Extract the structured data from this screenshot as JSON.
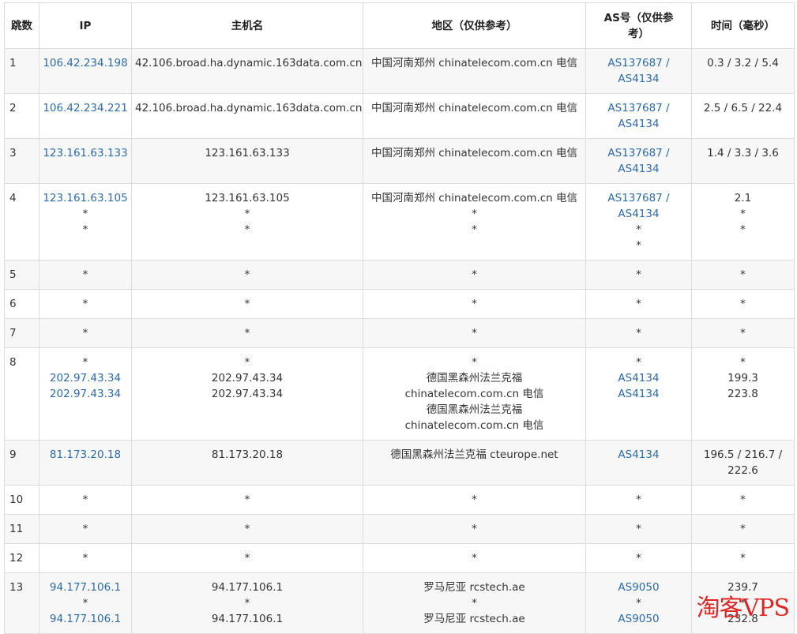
{
  "headers": {
    "hop": "跳数",
    "ip": "IP",
    "host": "主机名",
    "region": "地区（仅供参考）",
    "asn": "AS号（仅供参考）",
    "time": "时间（毫秒）"
  },
  "rows": [
    {
      "hop": "1",
      "ip": [
        "106.42.234.198"
      ],
      "host": [
        "42.106.broad.ha.dynamic.163data.com.cn"
      ],
      "region": [
        "中国河南郑州 chinatelecom.com.cn 电信"
      ],
      "asn": [
        "AS137687 /",
        "AS4134"
      ],
      "time": [
        "0.3 / 3.2 / 5.4"
      ]
    },
    {
      "hop": "2",
      "ip": [
        "106.42.234.221"
      ],
      "host": [
        "42.106.broad.ha.dynamic.163data.com.cn"
      ],
      "region": [
        "中国河南郑州 chinatelecom.com.cn 电信"
      ],
      "asn": [
        "AS137687 /",
        "AS4134"
      ],
      "time": [
        "2.5 / 6.5 / 22.4"
      ]
    },
    {
      "hop": "3",
      "ip": [
        "123.161.63.133"
      ],
      "host": [
        "123.161.63.133"
      ],
      "region": [
        "中国河南郑州 chinatelecom.com.cn 电信"
      ],
      "asn": [
        "AS137687 /",
        "AS4134"
      ],
      "time": [
        "1.4 / 3.3 / 3.6"
      ]
    },
    {
      "hop": "4",
      "ip": [
        "123.161.63.105",
        "*",
        "*"
      ],
      "host": [
        "123.161.63.105",
        "*",
        "*"
      ],
      "region": [
        "中国河南郑州 chinatelecom.com.cn 电信",
        "*",
        "*"
      ],
      "asn": [
        "AS137687 /",
        "AS4134",
        "*",
        "*"
      ],
      "time": [
        "2.1",
        "*",
        "*"
      ]
    },
    {
      "hop": "5",
      "ip": [
        "*"
      ],
      "host": [
        "*"
      ],
      "region": [
        "*"
      ],
      "asn": [
        "*"
      ],
      "time": [
        "*"
      ]
    },
    {
      "hop": "6",
      "ip": [
        "*"
      ],
      "host": [
        "*"
      ],
      "region": [
        "*"
      ],
      "asn": [
        "*"
      ],
      "time": [
        "*"
      ]
    },
    {
      "hop": "7",
      "ip": [
        "*"
      ],
      "host": [
        "*"
      ],
      "region": [
        "*"
      ],
      "asn": [
        "*"
      ],
      "time": [
        "*"
      ]
    },
    {
      "hop": "8",
      "ip": [
        "*",
        "202.97.43.34",
        "202.97.43.34"
      ],
      "host": [
        "*",
        "202.97.43.34",
        "202.97.43.34"
      ],
      "region": [
        "*",
        "德国黑森州法兰克福",
        "chinatelecom.com.cn 电信",
        "德国黑森州法兰克福",
        "chinatelecom.com.cn 电信"
      ],
      "asn": [
        "*",
        "AS4134",
        "AS4134"
      ],
      "time": [
        "*",
        "199.3",
        "223.8"
      ]
    },
    {
      "hop": "9",
      "ip": [
        "81.173.20.18"
      ],
      "host": [
        "81.173.20.18"
      ],
      "region": [
        "德国黑森州法兰克福 cteurope.net"
      ],
      "asn": [
        "AS4134"
      ],
      "time": [
        "196.5 / 216.7 /",
        "222.6"
      ]
    },
    {
      "hop": "10",
      "ip": [
        "*"
      ],
      "host": [
        "*"
      ],
      "region": [
        "*"
      ],
      "asn": [
        "*"
      ],
      "time": [
        "*"
      ]
    },
    {
      "hop": "11",
      "ip": [
        "*"
      ],
      "host": [
        "*"
      ],
      "region": [
        "*"
      ],
      "asn": [
        "*"
      ],
      "time": [
        "*"
      ]
    },
    {
      "hop": "12",
      "ip": [
        "*"
      ],
      "host": [
        "*"
      ],
      "region": [
        "*"
      ],
      "asn": [
        "*"
      ],
      "time": [
        "*"
      ]
    },
    {
      "hop": "13",
      "ip": [
        "94.177.106.1",
        "*",
        "94.177.106.1"
      ],
      "host": [
        "94.177.106.1",
        "*",
        "94.177.106.1"
      ],
      "region": [
        "罗马尼亚 rcstech.ae",
        "*",
        "罗马尼亚 rcstech.ae"
      ],
      "asn": [
        "AS9050",
        "*",
        "AS9050"
      ],
      "time": [
        "239.7",
        "*",
        "232.8"
      ]
    }
  ],
  "watermark": "淘客VPS",
  "colors": {
    "link": "#2d6aa8",
    "border": "#dcdcdc",
    "row_alt": "#f7f7f7",
    "watermark": "#e02525"
  }
}
